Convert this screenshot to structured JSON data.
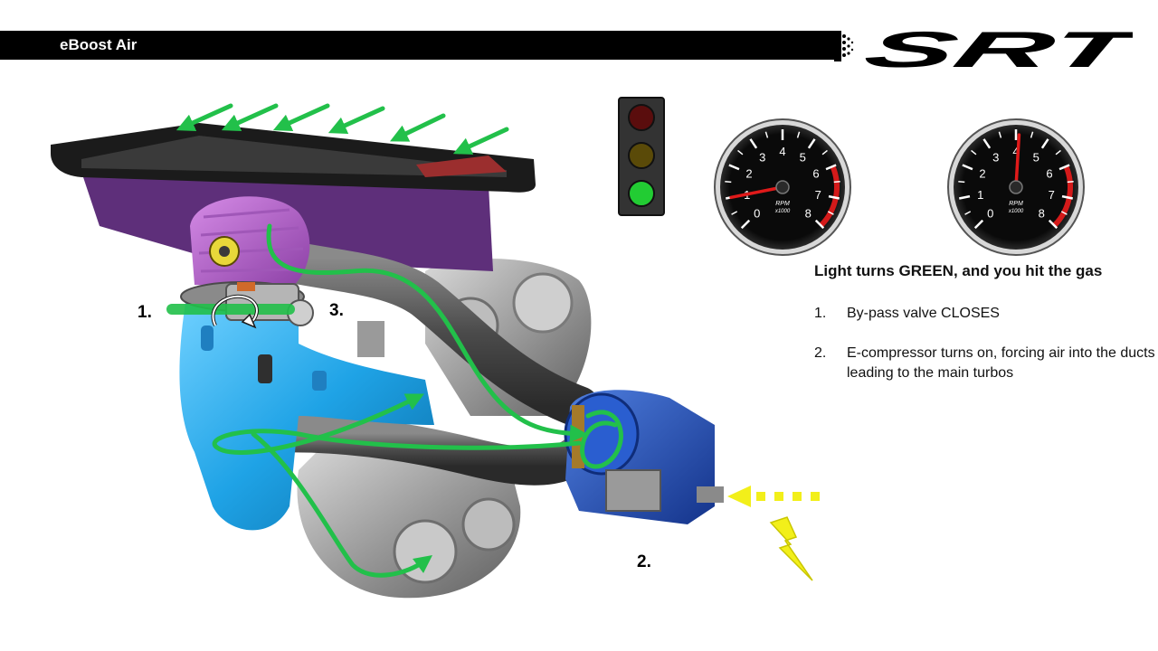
{
  "header": {
    "title": "eBoost Air",
    "logo_text": "SRT"
  },
  "diagram": {
    "callouts": {
      "bypass_valve": "1.",
      "e_compressor": "2.",
      "return_duct": "3."
    },
    "traffic_light": {
      "active": "green",
      "colors": {
        "red": "#5a0d0d",
        "amber": "#5a4a08",
        "green": "#22cc33"
      }
    },
    "tachometers": [
      {
        "label": "RPM",
        "unit": "x1000",
        "ticks": [
          "0",
          "1",
          "2",
          "3",
          "4",
          "5",
          "6",
          "7",
          "8"
        ],
        "needle_rpm_x1000": 1.0
      },
      {
        "label": "RPM",
        "unit": "x1000",
        "ticks": [
          "0",
          "1",
          "2",
          "3",
          "4",
          "5",
          "6",
          "7",
          "8"
        ],
        "needle_rpm_x1000": 4.1
      }
    ],
    "colors": {
      "airflow_arrow": "#22c04a",
      "electric_arrow": "#f2ef1a",
      "airbox": "#6a3a8a",
      "intake_pipe": "#1fa3e6",
      "e_compressor": "#1f4fb8"
    }
  },
  "text_panel": {
    "headline": "Light turns GREEN, and you hit the gas",
    "steps": [
      {
        "num": "1.",
        "text": "By-pass valve CLOSES"
      },
      {
        "num": "2.",
        "text": "E-compressor turns on, forcing air into the ducts leading to the main turbos"
      }
    ]
  }
}
